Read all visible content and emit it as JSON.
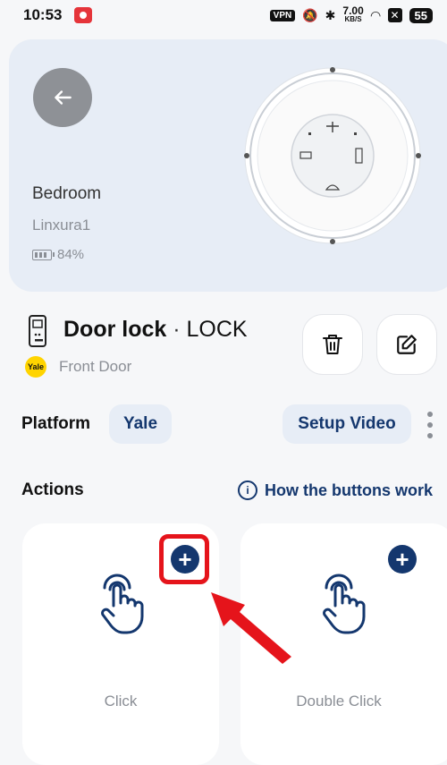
{
  "status_bar": {
    "time": "10:53",
    "vpn": "VPN",
    "speed_value": "7.00",
    "speed_unit": "KB/S",
    "x_badge": "✕",
    "battery": "55"
  },
  "device_card": {
    "back_icon": "arrow-left-icon",
    "room": "Bedroom",
    "hub_name": "Linxura1",
    "battery": "84%"
  },
  "device": {
    "name": "Door lock",
    "separator": "·",
    "type": "LOCK",
    "brand_badge": "Yale",
    "location": "Front Door"
  },
  "platform": {
    "label": "Platform",
    "value": "Yale",
    "setup_video": "Setup Video"
  },
  "actions": {
    "label": "Actions",
    "help_link": "How the buttons work",
    "items": [
      {
        "label": "Click",
        "add": "+"
      },
      {
        "label": "Double Click",
        "add": "+"
      }
    ]
  },
  "colors": {
    "accent": "#14376e",
    "highlight": "#e5141b",
    "card_bg": "#e7edf6"
  }
}
